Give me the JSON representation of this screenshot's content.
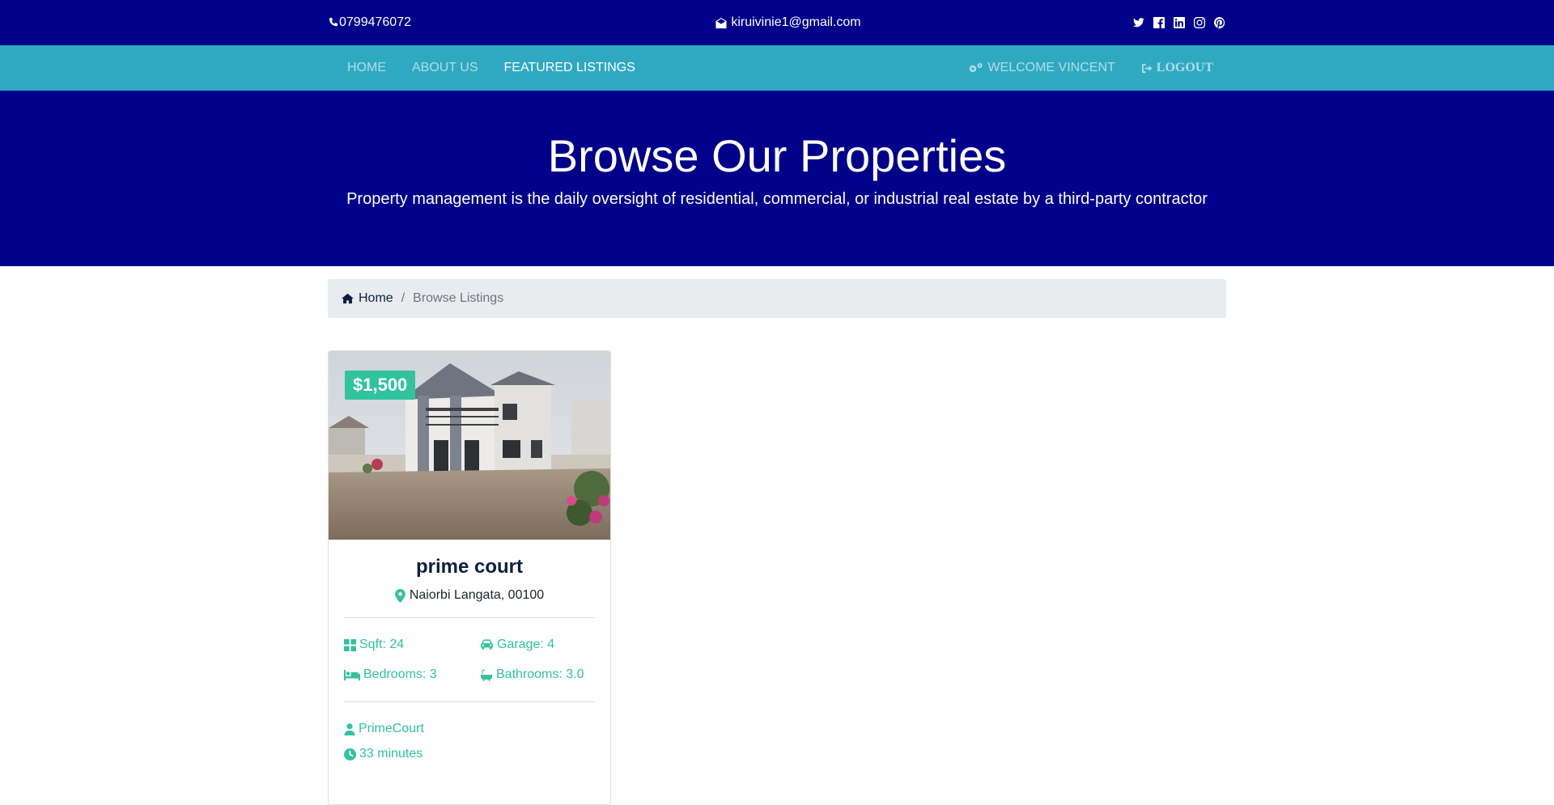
{
  "topbar": {
    "phone": "0799476072",
    "email": "kiruivinie1@gmail.com",
    "social_icons": [
      "twitter-icon",
      "facebook-icon",
      "linkedin-icon",
      "instagram-icon",
      "pinterest-icon"
    ]
  },
  "navbar": {
    "links": [
      "HOME",
      "ABOUT US",
      "FEATURED LISTINGS"
    ],
    "welcome": "WELCOME VINCENT",
    "logout": "LOGOUT"
  },
  "hero": {
    "title": "Browse Our Properties",
    "subtitle": "Property management is the daily oversight of residential, commercial, or industrial real estate by a third-party contractor"
  },
  "breadcrumb": {
    "home": "Home",
    "current": "Browse Listings"
  },
  "listing": {
    "price": "$1,500",
    "title": "prime court",
    "location": "Naiorbi Langata, 00100",
    "sqft": "Sqft: 24",
    "garage": "Garage: 4",
    "bedrooms": "Bedrooms: 3",
    "bathrooms": "Bathrooms: 3.0",
    "realtor": "PrimeCourt",
    "listed": "33 minutes"
  },
  "colors": {
    "topbar": "#00008b",
    "navbar": "#2fa9c1",
    "accent": "#30c39e"
  }
}
